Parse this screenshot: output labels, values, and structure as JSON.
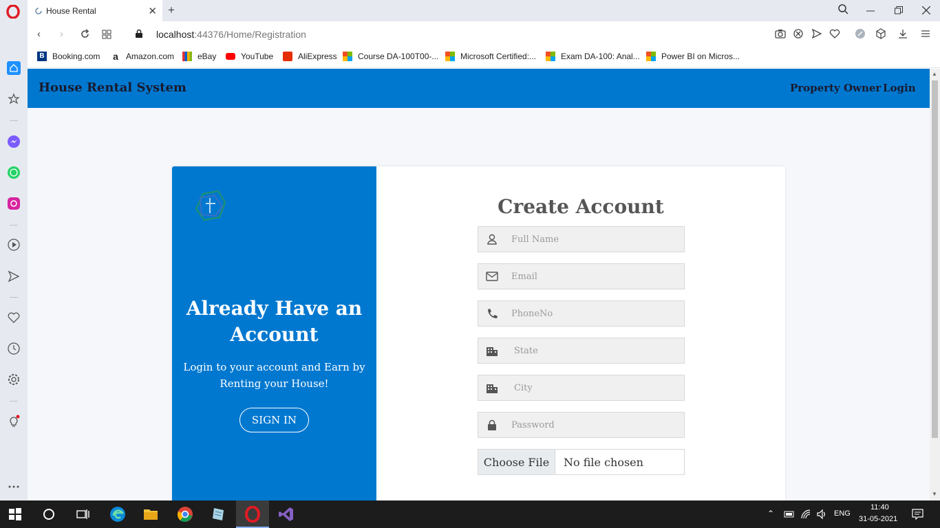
{
  "browser": {
    "tab_title": "House Rental",
    "url_host": "localhost",
    "url_rest": ":44376/Home/Registration"
  },
  "bookmarks": [
    {
      "label": "Booking.com"
    },
    {
      "label": "Amazon.com"
    },
    {
      "label": "eBay"
    },
    {
      "label": "YouTube"
    },
    {
      "label": "AliExpress"
    },
    {
      "label": "Course DA-100T00-..."
    },
    {
      "label": "Microsoft Certified:..."
    },
    {
      "label": "Exam DA-100: Anal..."
    },
    {
      "label": "Power BI on Micros..."
    }
  ],
  "navbar": {
    "brand": "House Rental System",
    "links": [
      "Property Owner",
      "Login"
    ]
  },
  "left_panel": {
    "title": "Already Have an Account",
    "text": "Login to your account and Earn by Renting your House!",
    "button": "SIGN IN"
  },
  "form": {
    "title": "Create Account",
    "fields": [
      {
        "placeholder": "Full Name",
        "icon": "user-icon"
      },
      {
        "placeholder": "Email",
        "icon": "envelope-icon"
      },
      {
        "placeholder": "PhoneNo",
        "icon": "phone-icon"
      },
      {
        "placeholder": "State",
        "icon": "building-icon"
      },
      {
        "placeholder": "City",
        "icon": "building-icon"
      },
      {
        "placeholder": "Password",
        "icon": "lock-icon"
      }
    ],
    "file_button": "Choose File",
    "file_status": "No file chosen"
  },
  "taskbar": {
    "language": "ENG",
    "time": "11:40",
    "date": "31-05-2021"
  },
  "colors": {
    "primary": "#0078d0",
    "page_bg": "#f5f7fb",
    "brand_text": "#1a1a2e"
  }
}
